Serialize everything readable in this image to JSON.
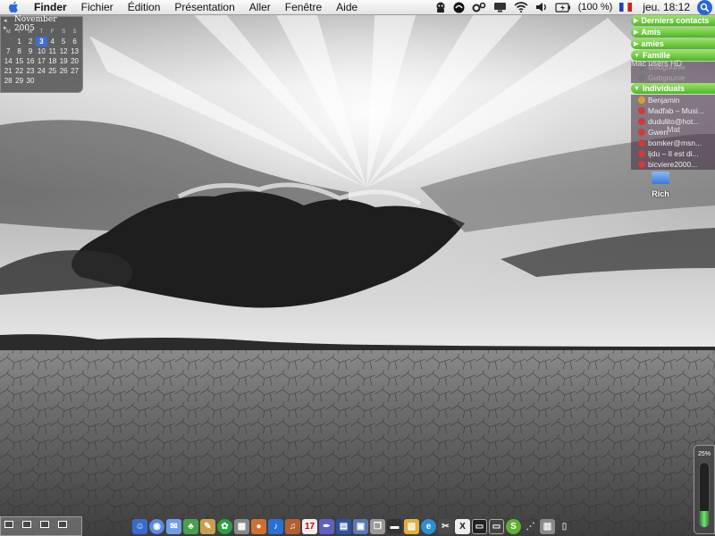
{
  "menubar": {
    "app": "Finder",
    "items": [
      "Fichier",
      "Édition",
      "Présentation",
      "Aller",
      "Fenêtre",
      "Aide"
    ],
    "battery_text": "(100 %)",
    "clock": "jeu. 18:12"
  },
  "calendar": {
    "month": "November 2005",
    "weekdays": [
      "M",
      "T",
      "W",
      "T",
      "F",
      "S",
      "S"
    ],
    "today": 3,
    "weeks": [
      [
        "",
        "1",
        "2",
        "3",
        "4",
        "5",
        "6"
      ],
      [
        "7",
        "8",
        "9",
        "10",
        "11",
        "12",
        "13"
      ],
      [
        "14",
        "15",
        "16",
        "17",
        "18",
        "19",
        "20"
      ],
      [
        "21",
        "22",
        "23",
        "24",
        "25",
        "26",
        "27"
      ],
      [
        "28",
        "29",
        "30",
        "",
        "",
        "",
        ""
      ]
    ]
  },
  "buddylist": {
    "groups": [
      {
        "name": "Derniers contacts",
        "expanded": false
      },
      {
        "name": "Amis",
        "expanded": false
      },
      {
        "name": "amies",
        "expanded": false
      },
      {
        "name": "Famille",
        "expanded": true,
        "buddies": [
          {
            "name": "Gabgounie",
            "status": "off"
          },
          {
            "name": "Gabgounie",
            "status": "off"
          }
        ]
      },
      {
        "name": "Individuals",
        "expanded": true,
        "buddies": [
          {
            "name": "Benjamin",
            "status": "away"
          },
          {
            "name": "Madfab – Musi...",
            "status": "busy"
          },
          {
            "name": "dudulito@hot...",
            "status": "busy"
          },
          {
            "name": "Gwen",
            "status": "busy"
          },
          {
            "name": "bomker@msn...",
            "status": "busy"
          },
          {
            "name": "ljdu – Il est di...",
            "status": "busy"
          },
          {
            "name": "bicviere2000...",
            "status": "busy"
          }
        ]
      }
    ],
    "overlay_1": "Mac users HD",
    "overlay_2": "Mat"
  },
  "desktop_icons": [
    {
      "label": "Rich"
    }
  ],
  "battery_widget": {
    "label": "25%",
    "level": 0.25
  },
  "colors": {
    "accent": "#3c6fd0",
    "buddy_group": "#4fb52a",
    "battery_fill": "#7ae07a"
  }
}
